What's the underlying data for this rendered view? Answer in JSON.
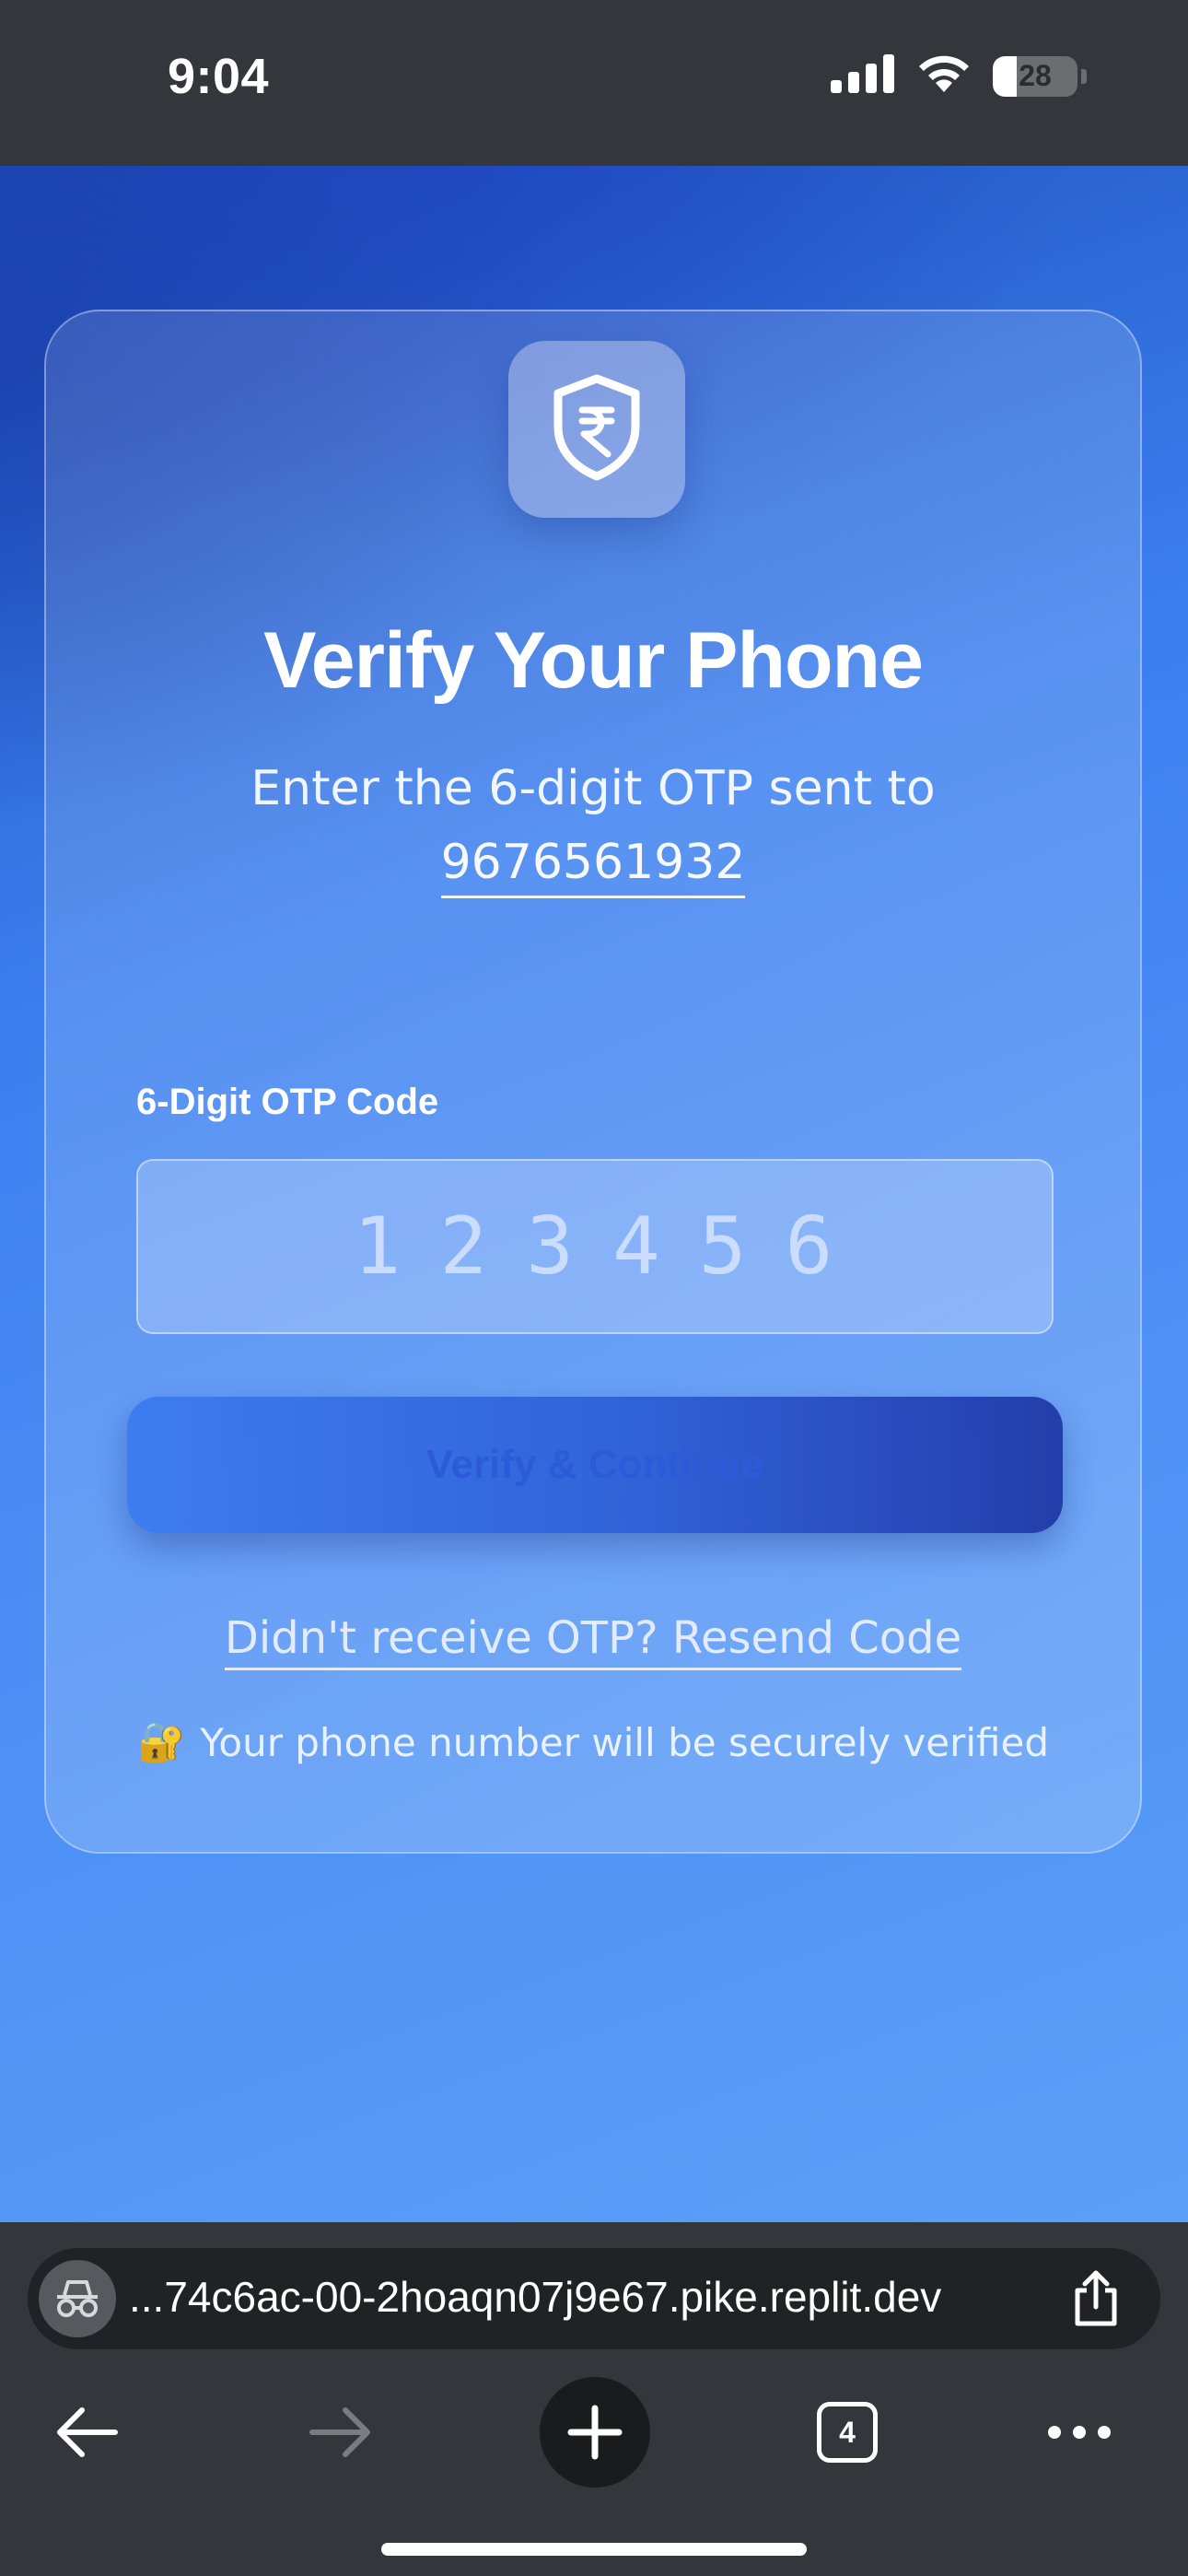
{
  "status_bar": {
    "time": "9:04",
    "battery": "28",
    "battery_level": 0.28,
    "icons": [
      "signal-icon",
      "wifi-icon",
      "battery-icon"
    ]
  },
  "colors": {
    "background_start": "#1d4fb8",
    "background_end": "#5aa0f8",
    "button_start": "#3b7cf0",
    "button_end": "#2039a8",
    "chrome": "#33363a"
  },
  "card": {
    "logo_icon": "rupee-shield-icon",
    "title": "Verify Your Phone",
    "subtitle": "Enter the 6-digit OTP sent to",
    "phone_number": "9676561932",
    "otp_label": "6-Digit OTP Code",
    "otp_placeholder": "123456",
    "otp_value": "",
    "verify_button": "Verify & Continue",
    "resend_link": "Didn't receive OTP? Resend Code",
    "secure_emoji": "🔐",
    "secure_note": "Your phone number will be securely verified"
  },
  "browser": {
    "url": "...74c6ac-00-2hoaqn07j9e67.pike.replit.dev",
    "tab_count": "4",
    "icons": [
      "incognito-icon",
      "share-icon",
      "back-icon",
      "forward-icon",
      "new-tab-icon",
      "tabs-icon",
      "more-icon"
    ]
  }
}
